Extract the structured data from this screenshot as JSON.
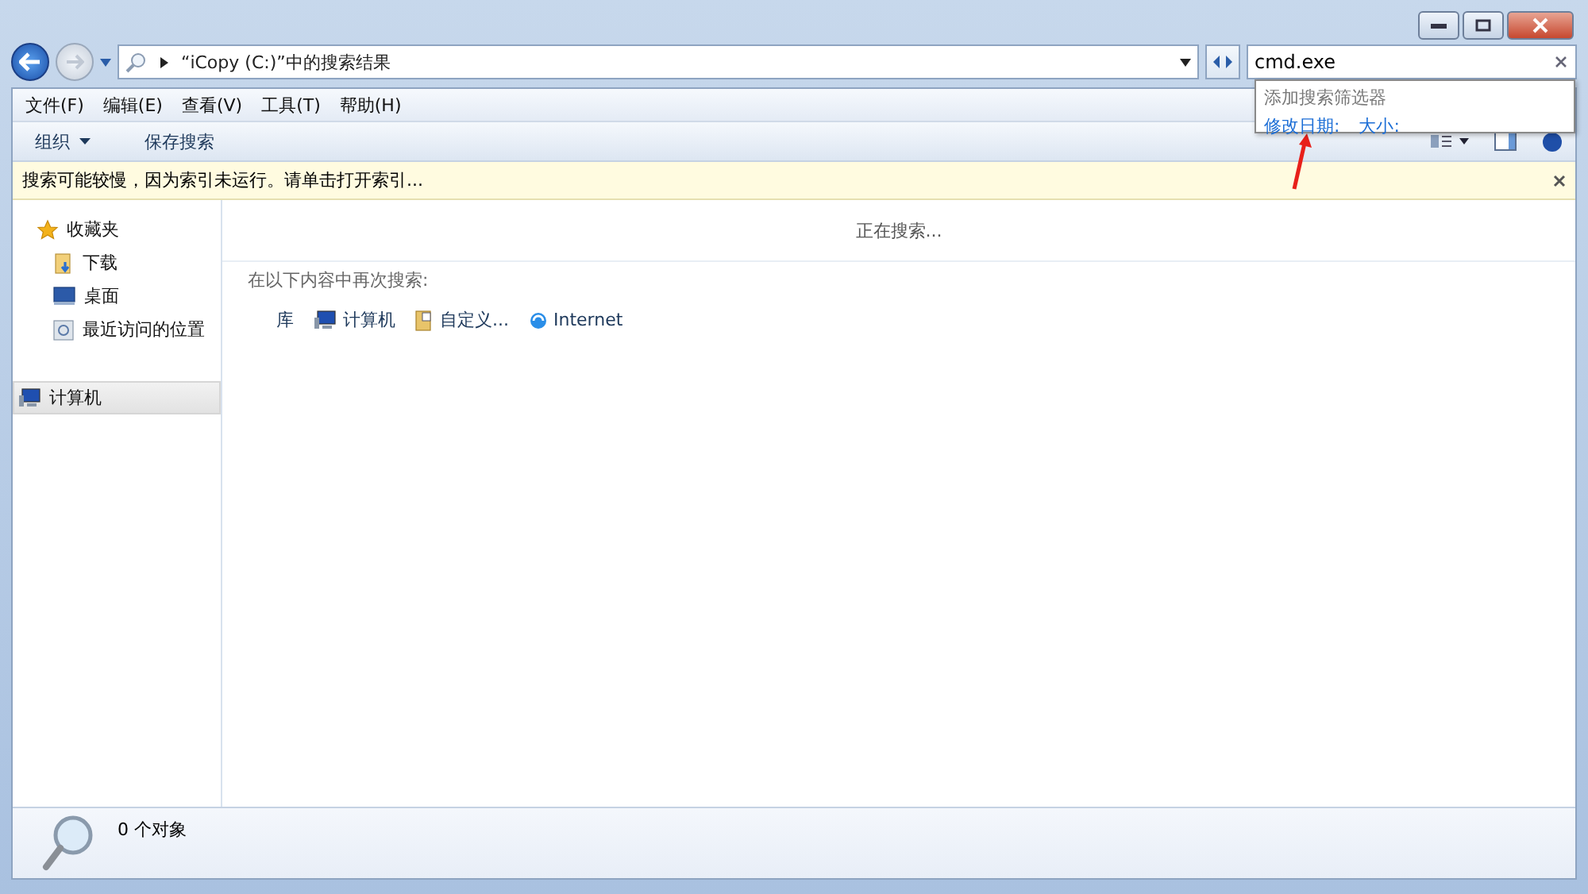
{
  "address": {
    "path": "“iCopy (C:)”中的搜索结果"
  },
  "search": {
    "value": "cmd.exe",
    "suggestions": {
      "heading": "添加搜索筛选器",
      "filters": [
        "修改日期:",
        "大小:"
      ]
    }
  },
  "menu": [
    "文件(F)",
    "编辑(E)",
    "查看(V)",
    "工具(T)",
    "帮助(H)"
  ],
  "toolbar": [
    {
      "label": "组织",
      "kind": "menu"
    },
    {
      "label": "保存搜索",
      "kind": "button"
    }
  ],
  "info_bar": {
    "message": "搜索可能较慢，因为索引未运行。请单击打开索引..."
  },
  "sidebar": [
    {
      "label": "收藏夹",
      "kind": "star",
      "selected": false,
      "children": [
        {
          "label": "下载",
          "kind": "download",
          "selected": false
        },
        {
          "label": "桌面",
          "kind": "desktop",
          "selected": false
        },
        {
          "label": "最近访问的位置",
          "kind": "recent",
          "selected": false
        }
      ]
    },
    {
      "label": "计算机",
      "kind": "computer",
      "selected": true
    }
  ],
  "content": {
    "status": "正在搜索...",
    "search_again": {
      "label": "在以下内容中再次搜索:",
      "targets": [
        {
          "label": "库",
          "kind": "library"
        },
        {
          "label": "计算机",
          "kind": "computer"
        },
        {
          "label": "自定义...",
          "kind": "custom"
        },
        {
          "label": "Internet",
          "kind": "internet"
        }
      ]
    }
  },
  "status_bar": {
    "count": "0 个对象"
  }
}
